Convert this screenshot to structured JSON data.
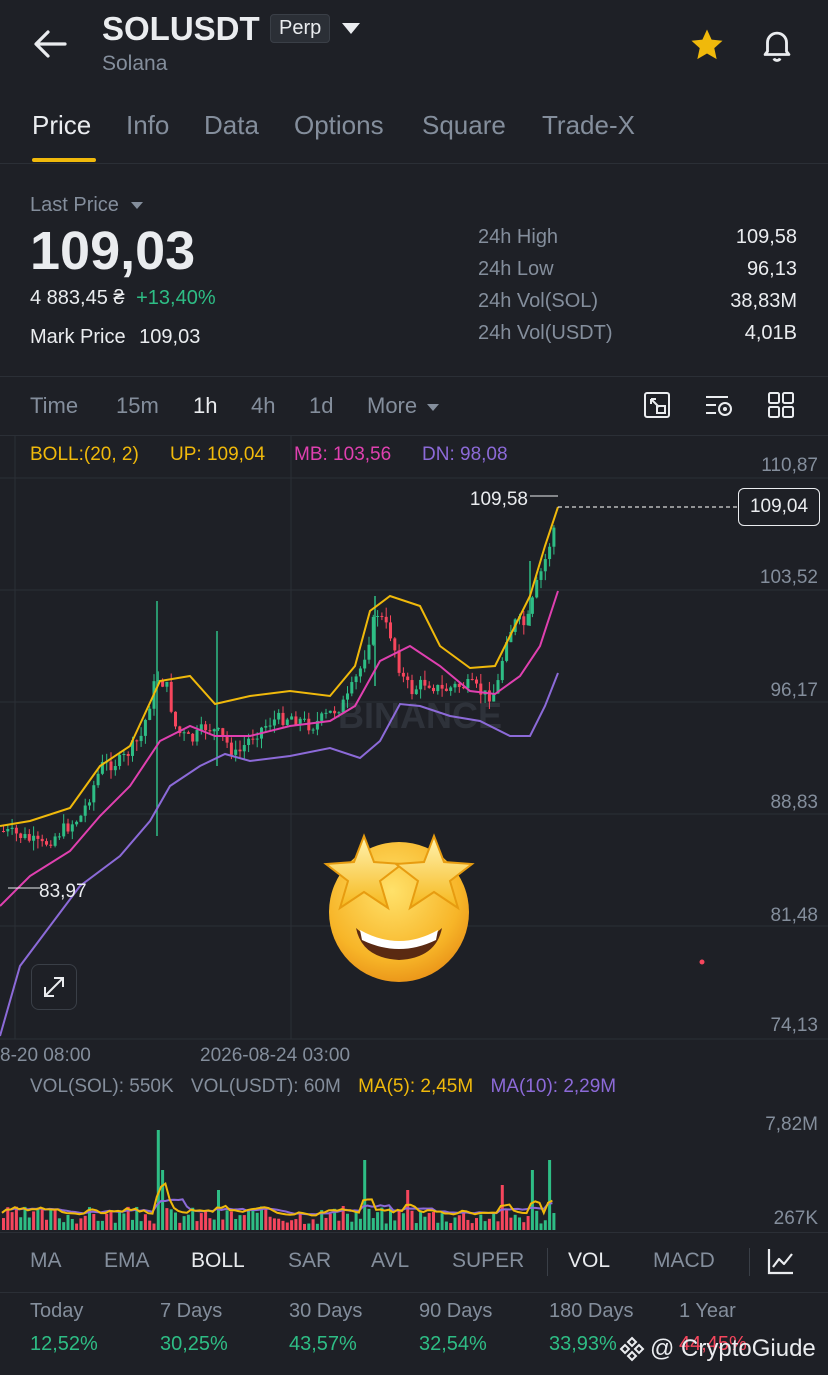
{
  "header": {
    "symbol": "SOLUSDT",
    "badge": "Perp",
    "name": "Solana"
  },
  "tabs": [
    {
      "label": "Price"
    },
    {
      "label": "Info"
    },
    {
      "label": "Data"
    },
    {
      "label": "Options"
    },
    {
      "label": "Square"
    },
    {
      "label": "Trade-X"
    }
  ],
  "price": {
    "last_price_label": "Last Price",
    "last_price": "109,03",
    "converted": "4 883,45 ₴",
    "change": "+13,40%",
    "mark_price_label": "Mark Price",
    "mark_price": "109,03"
  },
  "stats": [
    {
      "label": "24h High",
      "value": "109,58"
    },
    {
      "label": "24h Low",
      "value": "96,13"
    },
    {
      "label": "24h Vol(SOL)",
      "value": "38,83M"
    },
    {
      "label": "24h Vol(USDT)",
      "value": "4,01B"
    }
  ],
  "timeframes": [
    {
      "label": "Time"
    },
    {
      "label": "15m"
    },
    {
      "label": "1h"
    },
    {
      "label": "4h"
    },
    {
      "label": "1d"
    },
    {
      "label": "More"
    }
  ],
  "boll_legend": {
    "params": "BOLL:(20, 2)",
    "up": "UP: 109,04",
    "mb": "MB: 103,56",
    "dn": "DN: 98,08"
  },
  "price_axis": [
    "110,87",
    "103,52",
    "96,17",
    "88,83",
    "81,48",
    "74,13"
  ],
  "current_price_tag": "109,04",
  "high_marker": "109,58",
  "low_marker": "83,97",
  "time_axis": [
    "8-20 08:00",
    "2026-08-24 03:00"
  ],
  "watermark": "BINANCE",
  "vol_legend": {
    "sol": "VOL(SOL): 550K",
    "usdt": "VOL(USDT): 60M",
    "ma5": "MA(5): 2,45M",
    "ma10": "MA(10): 2,29M"
  },
  "vol_axis": [
    "7,82M",
    "267K"
  ],
  "indicators": [
    {
      "label": "MA"
    },
    {
      "label": "EMA"
    },
    {
      "label": "BOLL"
    },
    {
      "label": "SAR"
    },
    {
      "label": "AVL"
    },
    {
      "label": "SUPER"
    },
    {
      "label": "VOL"
    },
    {
      "label": "MACD"
    }
  ],
  "performance": [
    {
      "label": "Today",
      "value": "12,52%"
    },
    {
      "label": "7 Days",
      "value": "30,25%"
    },
    {
      "label": "30 Days",
      "value": "43,57%"
    },
    {
      "label": "90 Days",
      "value": "32,54%"
    },
    {
      "label": "180 Days",
      "value": "33,93%"
    },
    {
      "label": "1 Year",
      "value": "44,45%"
    }
  ],
  "credit": "@ CryptoGiude",
  "colors": {
    "accent": "#f0b90b",
    "up": "#2ebd85",
    "down": "#f6465d",
    "boll_up": "#f0b90b",
    "boll_mb": "#e040b0",
    "boll_dn": "#8c6ad8"
  },
  "icons": [
    "back-arrow-icon",
    "caret-down-icon",
    "star-icon",
    "bell-icon",
    "fullscreen-icon",
    "indicator-settings-icon",
    "grid-icon",
    "expand-icon",
    "star-struck-emoji",
    "chart-icon"
  ]
}
